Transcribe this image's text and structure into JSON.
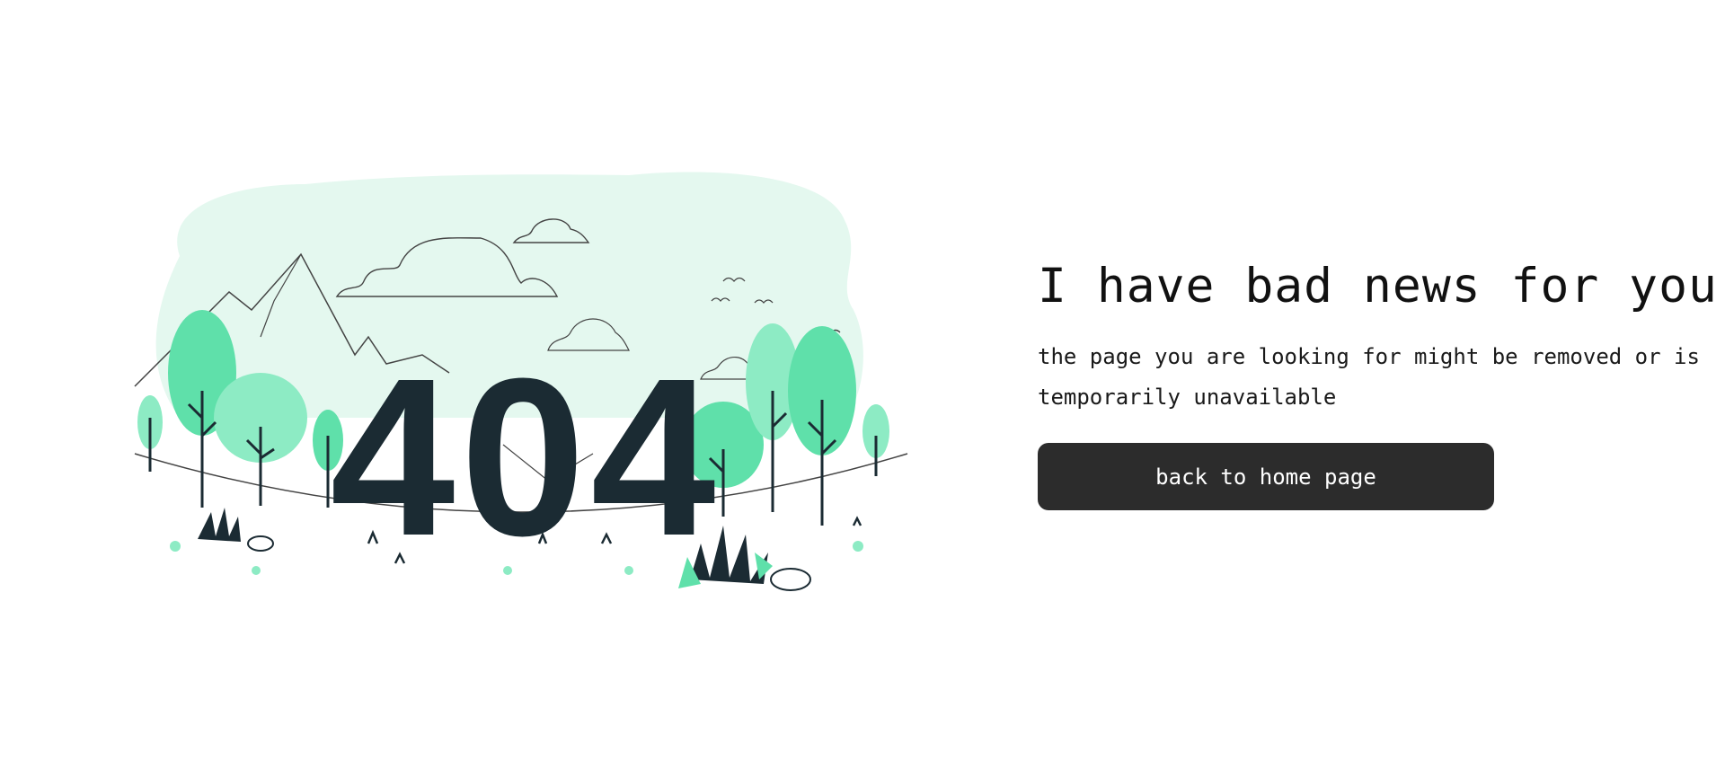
{
  "illustration": {
    "error_code": "404",
    "accent_color": "#5fe0aa",
    "light_accent_color": "#e4f8ef",
    "dark_color": "#1b2b33"
  },
  "content": {
    "headline": "I have bad news for you",
    "message": "the page you are looking for might be removed or is temporarily unavailable",
    "button_label": "back to home page",
    "button_color": "#2c2c2c"
  }
}
